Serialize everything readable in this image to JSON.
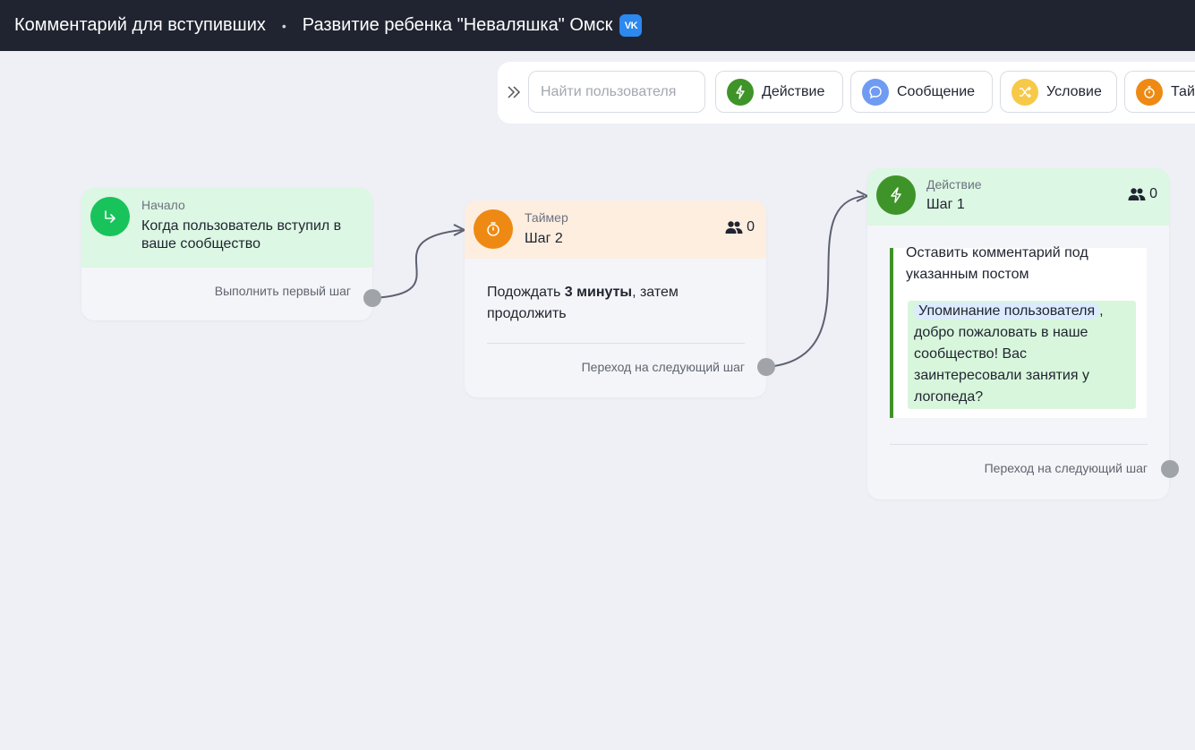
{
  "header": {
    "title": "Комментарий для вступивших",
    "separator": "•",
    "community": "Развитие ребенка \"Неваляшка\" Омск",
    "vk_badge": "VK"
  },
  "toolbar": {
    "search_placeholder": "Найти пользователя",
    "buttons": [
      {
        "label": "Действие",
        "icon": "lightning-icon",
        "color": "#3f9429"
      },
      {
        "label": "Сообщение",
        "icon": "chat-bubble-icon",
        "color": "#6f9bf2"
      },
      {
        "label": "Условие",
        "icon": "shuffle-icon",
        "color": "#f7c949"
      },
      {
        "label": "Тай",
        "icon": "timer-icon",
        "color": "#ee8a13"
      }
    ]
  },
  "nodes": {
    "start": {
      "kind": "Начало",
      "title": "Когда пользователь вступил в ваше сообщество",
      "footer": "Выполнить первый шаг",
      "color": "#19c35c"
    },
    "timer": {
      "kind": "Таймер",
      "title": "Шаг 2",
      "count": "0",
      "body_prefix": "Подождать ",
      "body_bold": "3 минуты",
      "body_suffix": ", затем продолжить",
      "footer": "Переход на следующий шаг",
      "color": "#ee8a13"
    },
    "action": {
      "kind": "Действие",
      "title": "Шаг 1",
      "count": "0",
      "body_title": "Оставить комментарий под указанным постом",
      "mention": "Упоминание пользователя",
      "message_after": ", добро пожаловать в наше сообщество! Вас заинтересовали занятия у логопеда?",
      "footer": "Переход на следующий шаг",
      "color": "#3f9429"
    }
  }
}
